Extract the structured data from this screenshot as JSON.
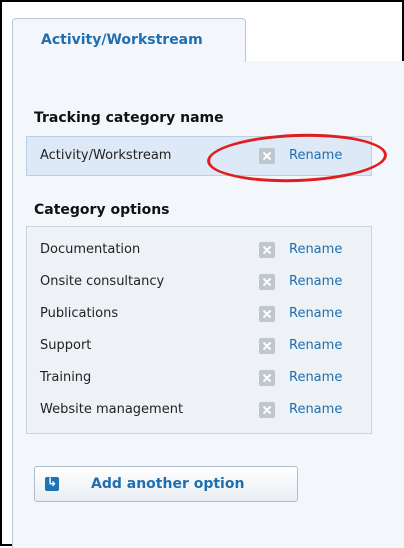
{
  "tab": {
    "label": "Activity/Workstream"
  },
  "tracking_category": {
    "title": "Tracking category name",
    "value": "Activity/Workstream",
    "rename_label": "Rename"
  },
  "category_options": {
    "title": "Category options",
    "items": [
      {
        "label": "Documentation",
        "rename_label": "Rename"
      },
      {
        "label": "Onsite consultancy",
        "rename_label": "Rename"
      },
      {
        "label": "Publications",
        "rename_label": "Rename"
      },
      {
        "label": "Support",
        "rename_label": "Rename"
      },
      {
        "label": "Training",
        "rename_label": "Rename"
      },
      {
        "label": "Website management",
        "rename_label": "Rename"
      }
    ]
  },
  "add_button": {
    "label": "Add another option"
  },
  "colors": {
    "link": "#1f6fb0",
    "highlight_ellipse": "#e01e1e",
    "panel_bg": "#f3f6fa",
    "selected_row_bg": "#dde9f7"
  },
  "icons": {
    "delete": "x-icon",
    "add": "add-arrow-icon"
  }
}
